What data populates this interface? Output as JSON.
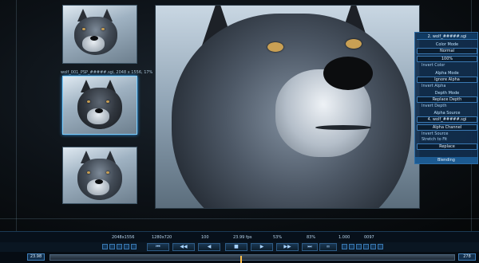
{
  "thumbnail_label": "wolf_001_PSP_#####.sgi, 2048 x 1556, 17%",
  "panel": {
    "title": "2. wolf_#####.sgi",
    "color_mode": {
      "heading": "Color Mode",
      "value": "Normal",
      "opacity": "100%",
      "invert_label": "Invert Color"
    },
    "alpha_mode": {
      "heading": "Alpha Mode",
      "value": "Ignore Alpha",
      "invert_label": "Invert Alpha"
    },
    "depth_mode": {
      "heading": "Depth Mode",
      "value": "Replace Depth",
      "invert_label": "Invert Depth"
    },
    "alpha_source": {
      "heading": "Alpha Source",
      "source": "4. wolf_#####.sgi",
      "channel": "Alpha Channel",
      "invert_label": "Invert Source"
    },
    "stretch_label": "Stretch to Fit",
    "replace_value": "Replace",
    "footer": "Blending"
  },
  "info_bar": {
    "resolution_a": "2048x1556",
    "resolution_b": "1280x720",
    "zoom": "100",
    "fps": "23.99 fps",
    "pct_a": "53%",
    "pct_b": "83%",
    "ratio": "1.000",
    "frame": "0097"
  },
  "timeline": {
    "start": "23.98",
    "end": "278"
  },
  "colors": {
    "accent": "#3aa9ff",
    "panel": "#122e4e",
    "handle": "#ffc04a"
  }
}
